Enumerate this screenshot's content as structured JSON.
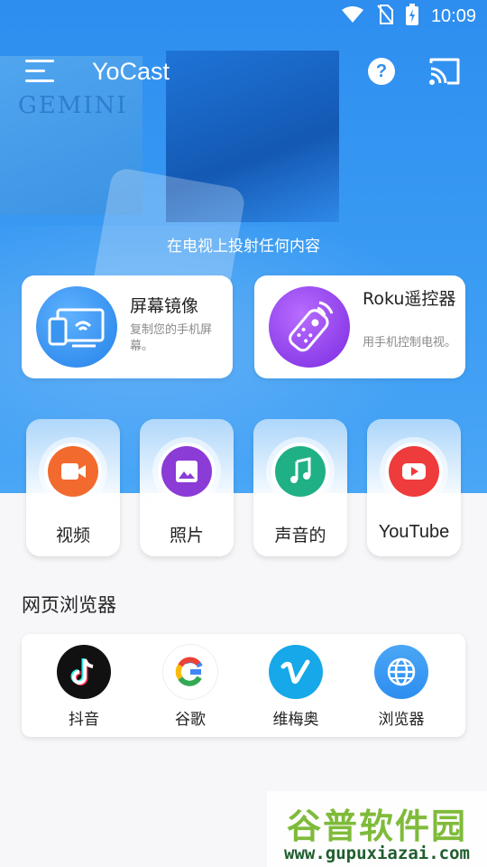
{
  "status_bar": {
    "time": "10:09",
    "icons": [
      "wifi-icon",
      "no-sim-icon",
      "battery-charging-icon"
    ]
  },
  "app": {
    "title": "YoCast",
    "tagline": "在电视上投射任何内容"
  },
  "hero_art": {
    "poster_text": "GEMINI"
  },
  "features": {
    "mirror": {
      "title": "屏幕镜像",
      "subtitle": "复制您的手机屏幕。"
    },
    "roku": {
      "title": "Roku遥控器",
      "subtitle": "用手机控制电视。"
    }
  },
  "media": {
    "video": {
      "label": "视频",
      "color": "#f26a2e"
    },
    "photo": {
      "label": "照片",
      "color": "#8b3bd6"
    },
    "audio": {
      "label": "声音的",
      "color": "#1fb085"
    },
    "youtube": {
      "label": "YouTube",
      "color": "#ee3b3b"
    }
  },
  "browser_section": {
    "title": "网页浏览器",
    "items": [
      {
        "label": "抖音",
        "icon": "tiktok-icon"
      },
      {
        "label": "谷歌",
        "icon": "google-icon"
      },
      {
        "label": "维梅奥",
        "icon": "vimeo-icon"
      },
      {
        "label": "浏览器",
        "icon": "globe-icon"
      }
    ]
  },
  "watermark": {
    "name": "谷普软件园",
    "url": "www.gupuxiazai.com"
  },
  "colors": {
    "primary": "#2d8ef0",
    "accent_light": "#4aa6f6"
  }
}
